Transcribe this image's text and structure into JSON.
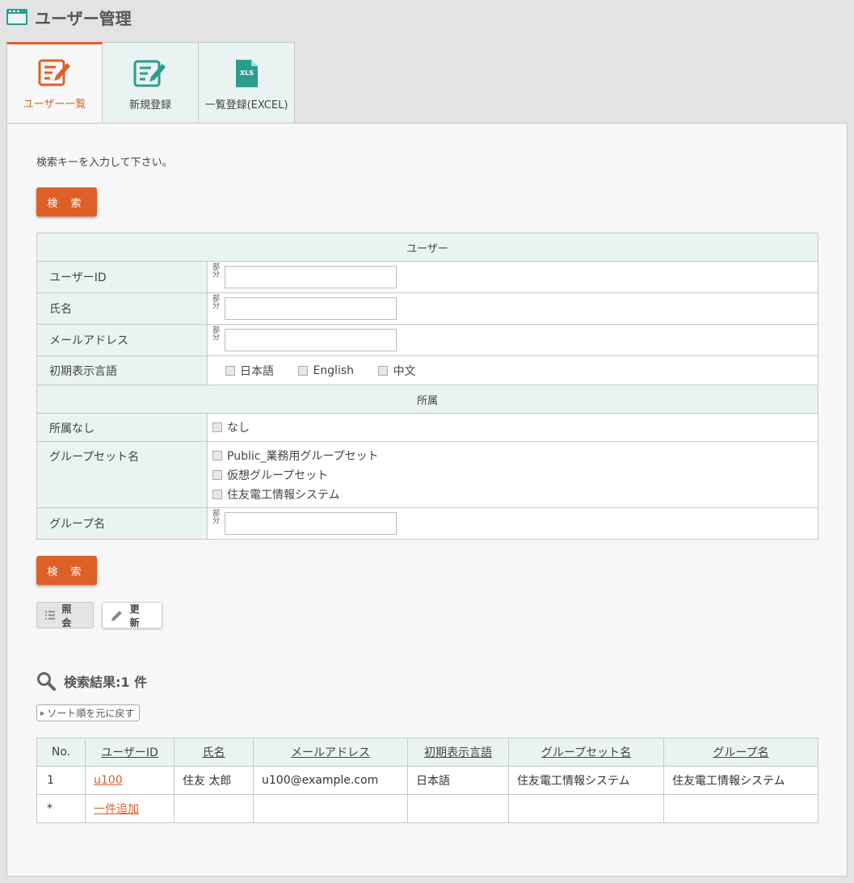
{
  "page": {
    "title": "ユーザー管理"
  },
  "tabs": [
    {
      "label": "ユーザー一覧",
      "active": true
    },
    {
      "label": "新規登録"
    },
    {
      "label": "一覧登録(EXCEL)"
    }
  ],
  "xls_icon_text": "XLS",
  "search": {
    "hint": "検索キーを入力して下さい。",
    "button_label": "検 索",
    "partial_label": "部分",
    "section_user": "ユーザー",
    "section_affiliation": "所属",
    "fields": {
      "user_id": "ユーザーID",
      "name": "氏名",
      "email": "メールアドレス",
      "language": "初期表示言語",
      "no_affiliation": "所属なし",
      "group_set": "グループセット名",
      "group": "グループ名"
    },
    "languages": [
      "日本語",
      "English",
      "中文"
    ],
    "none_label": "なし",
    "group_sets": [
      "Public_業務用グループセット",
      "仮想グループセット",
      "住友電工情報システム"
    ]
  },
  "modes": {
    "view": "照会",
    "edit": "更新"
  },
  "results": {
    "title": "検索結果:1 件",
    "sort_reset": "ソート順を元に戻す",
    "columns": [
      "No.",
      "ユーザーID",
      "氏名",
      "メールアドレス",
      "初期表示言語",
      "グループセット名",
      "グループ名"
    ],
    "rows": [
      {
        "no": "1",
        "user_id": "u100",
        "name": "住友 太郎",
        "email": "u100@example.com",
        "language": "日本語",
        "group_set": "住友電工情報システム",
        "group": "住友電工情報システム"
      }
    ],
    "add_row": {
      "no": "*",
      "label": "一件追加"
    }
  },
  "colors": {
    "accent": "#de5f27",
    "teal": "#2a9d8f",
    "header_bg": "#e9f3f1"
  }
}
